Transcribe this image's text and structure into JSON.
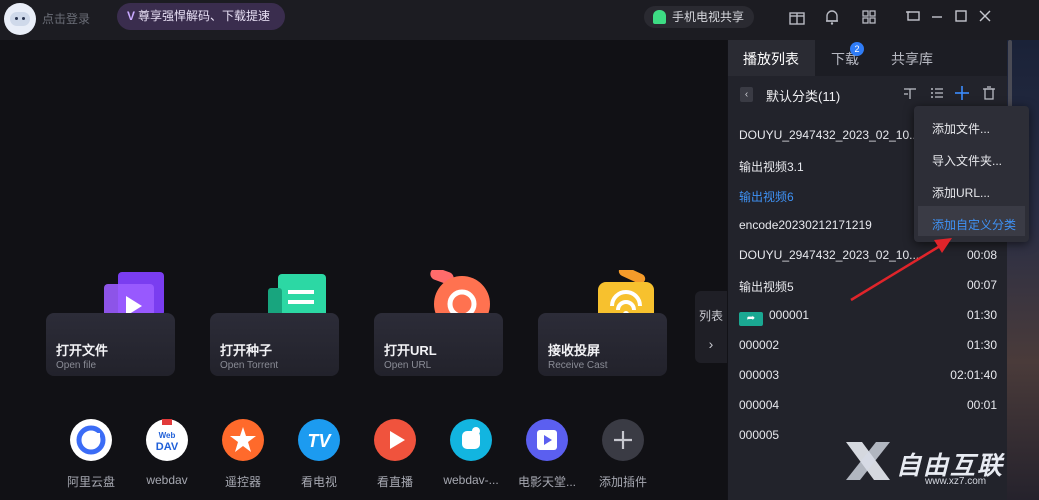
{
  "topbar": {
    "login_label": "点击登录",
    "vip_label": "尊享强悍解码、下载提速",
    "share_tv_label": "手机电视共享"
  },
  "main": {
    "cards": [
      {
        "title": "打开文件",
        "subtitle": "Open file"
      },
      {
        "title": "打开种子",
        "subtitle": "Open Torrent"
      },
      {
        "title": "打开URL",
        "subtitle": "Open URL"
      },
      {
        "title": "接收投屏",
        "subtitle": "Receive Cast"
      }
    ],
    "plugins": [
      {
        "label": "阿里云盘",
        "color": "#ffffff",
        "icon": "aliyun-drive-icon"
      },
      {
        "label": "webdav",
        "color": "#ffffff",
        "icon": "webdav-icon"
      },
      {
        "label": "遥控器",
        "color": "#ff6a2b",
        "icon": "remote-control-icon"
      },
      {
        "label": "看电视",
        "color": "#1c9bf0",
        "icon": "tv-icon"
      },
      {
        "label": "看直播",
        "color": "#f0533d",
        "icon": "live-icon"
      },
      {
        "label": "webdav-...",
        "color": "#12b5e0",
        "icon": "webdav-plugin-icon"
      },
      {
        "label": "电影天堂...",
        "color": "#5b5ff0",
        "icon": "movie-icon"
      },
      {
        "label": "添加插件",
        "color": "#3a3b44",
        "icon": "add-plugin-icon"
      }
    ],
    "side_toggle_label": "列表"
  },
  "panel": {
    "tabs": [
      {
        "label": "播放列表"
      },
      {
        "label": "下载"
      },
      {
        "label": "共享库"
      }
    ],
    "download_badge": "2",
    "category_title": "默认分类(11)",
    "items": [
      {
        "name": "DOUYU_2947432_2023_02_10...",
        "duration": ""
      },
      {
        "name": "输出视频3.1",
        "duration": ""
      },
      {
        "name": "输出视频6",
        "duration": ""
      },
      {
        "name": "encode20230212171219",
        "duration": ""
      },
      {
        "name": "DOUYU_2947432_2023_02_10...",
        "duration": "00:08"
      },
      {
        "name": "输出视频5",
        "duration": "00:07"
      },
      {
        "name": "000001",
        "duration": "01:30"
      },
      {
        "name": "000002",
        "duration": "01:30"
      },
      {
        "name": "000003",
        "duration": "02:01:40"
      },
      {
        "name": "000004",
        "duration": "00:01"
      },
      {
        "name": "000005",
        "duration": ""
      }
    ]
  },
  "context_menu": {
    "items": [
      {
        "label": "添加文件..."
      },
      {
        "label": "导入文件夹..."
      },
      {
        "label": "添加URL..."
      },
      {
        "label": "添加自定义分类"
      }
    ]
  },
  "watermark": {
    "brand": "自由互联",
    "url": "www.xz7.com"
  },
  "colors": {
    "accent": "#3f92f5",
    "annotation_arrow": "#e0242a"
  }
}
